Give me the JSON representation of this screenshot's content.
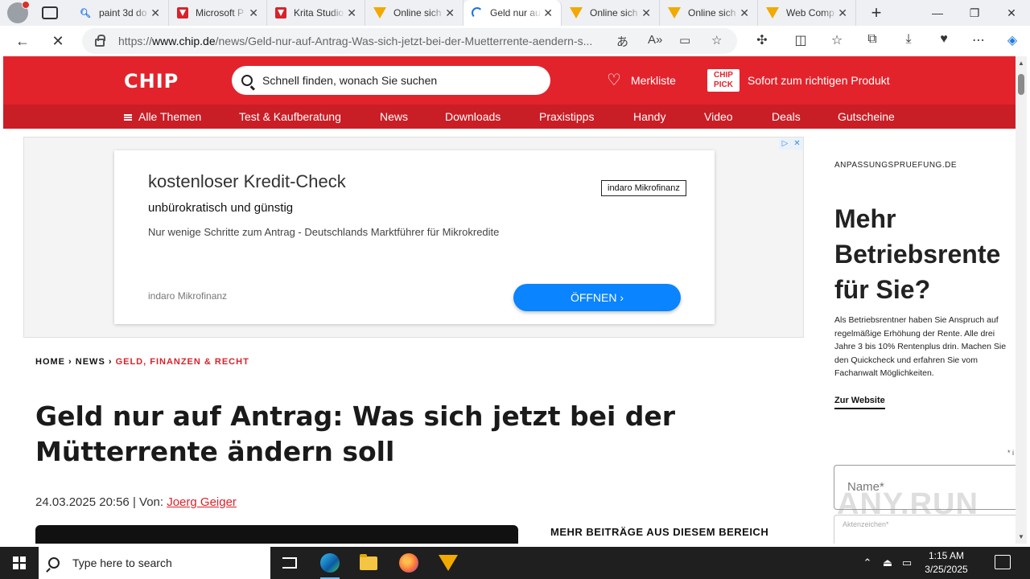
{
  "browser": {
    "tabs": [
      {
        "title": "paint 3d do",
        "icon": "search-icon",
        "active": false
      },
      {
        "title": "Microsoft P",
        "icon": "red-flag-icon",
        "active": false
      },
      {
        "title": "Krita Studio",
        "icon": "red-flag-icon",
        "active": false
      },
      {
        "title": "Online sich",
        "icon": "orange-cone-icon",
        "active": false
      },
      {
        "title": "Geld nur au",
        "icon": "loading-spinner-icon",
        "active": true
      },
      {
        "title": "Online sich",
        "icon": "orange-cone-icon",
        "active": false
      },
      {
        "title": "Online sich",
        "icon": "orange-cone-icon",
        "active": false
      },
      {
        "title": "Web Comp",
        "icon": "orange-cone-icon",
        "active": false
      }
    ],
    "url_prefix": "https://",
    "url_domain": "www.chip.de",
    "url_path": "/news/Geld-nur-auf-Antrag-Was-sich-jetzt-bei-der-Muetterrente-aendern-s..."
  },
  "chip": {
    "logo": "CHIP",
    "search_placeholder": "Schnell finden, wonach Sie suchen",
    "merkliste": "Merkliste",
    "pick_logo": "CHIP PICK",
    "pick_text": "Sofort zum richtigen Produkt",
    "nav": [
      "Alle Themen",
      "Test & Kaufberatung",
      "News",
      "Downloads",
      "Praxistipps",
      "Handy",
      "Video",
      "Deals",
      "Gutscheine"
    ]
  },
  "ad": {
    "title": "kostenloser Kredit-Check",
    "subtitle": "unbürokratisch und günstig",
    "description": "Nur wenige Schritte zum Antrag - Deutschlands Marktführer für Mikrokredite",
    "brand_box": "indaro Mikrofinanz",
    "brand": "indaro Mikrofinanz",
    "button": "ÖFFNEN"
  },
  "article": {
    "breadcrumb_home": "HOME",
    "breadcrumb_news": "NEWS",
    "breadcrumb_category": "GELD, FINANZEN & RECHT",
    "headline": "Geld nur auf Antrag: Was sich jetzt bei der Mütterrente ändern soll",
    "date": "24.03.2025 20:56",
    "by": "| Von:",
    "author": "Joerg Geiger",
    "more_title": "MEHR BEITRÄGE AUS DIESEM BEREICH"
  },
  "sidebar_ad": {
    "source": "ANPASSUNGSPRUEFUNG.DE",
    "headline": "Mehr Betriebsrente für Sie?",
    "text": "Als Betriebsrentner haben Sie Anspruch auf regelmäßige Erhöhung der Rente. Alle drei Jahre 3 bis 10% Rentenplus drin. Machen Sie den Quickcheck und erfahren Sie vom Fachanwalt Möglichkeiten.",
    "link": "Zur Website",
    "required_mark": "* i",
    "field_name": "Name*",
    "field_second": "Aktenzeichen*"
  },
  "watermark": "ANY.RUN",
  "taskbar": {
    "search_placeholder": "Type here to search",
    "time": "1:15 AM",
    "date": "3/25/2025"
  }
}
